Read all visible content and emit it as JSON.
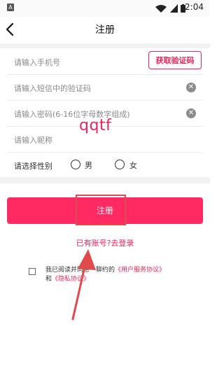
{
  "status_bar": {
    "time": "2:04"
  },
  "header": {
    "title": "注册"
  },
  "form": {
    "phone_placeholder": "请输入手机号",
    "get_code_label": "获取验证码",
    "sms_code_placeholder": "请输入短信中的验证码",
    "password_placeholder": "请输入密码(6-16位字母数字组成)",
    "nickname_placeholder": "请输入昵称",
    "gender_label": "请选择性别",
    "gender_options": [
      "男",
      "女"
    ]
  },
  "watermark": "qqtf",
  "register_button_label": "注册",
  "login_link": "已有账号?去登录",
  "agreement": {
    "prefix": "我已阅读并同意一聊约的",
    "user_agreement": "《用户服务协议》",
    "joiner": "和",
    "privacy_policy": "《隐私协议》"
  },
  "colors": {
    "accent": "#ff2a62",
    "annotation": "#e04a4a"
  }
}
